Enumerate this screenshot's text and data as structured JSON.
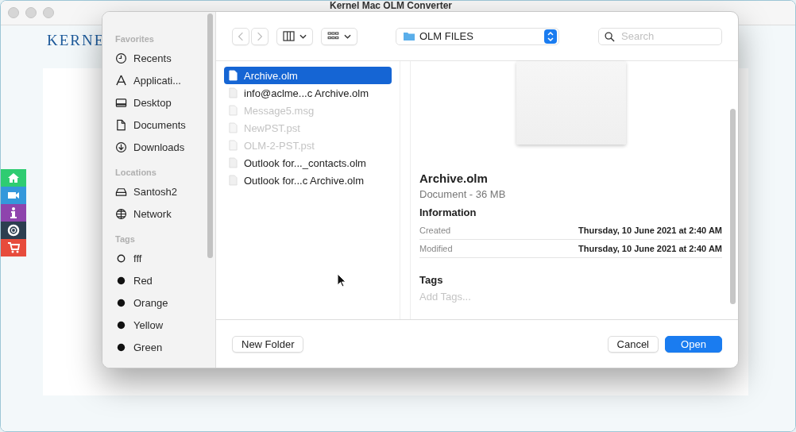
{
  "app_window": {
    "title": "Kernel Mac OLM Converter",
    "logo": "KERNE",
    "side_tabs": [
      {
        "kind": "home",
        "color": "#2ecc71"
      },
      {
        "kind": "video",
        "color": "#3498db"
      },
      {
        "kind": "info",
        "color": "#8e44ad"
      },
      {
        "kind": "help",
        "color": "#2c3e50"
      },
      {
        "kind": "cart",
        "color": "#e74c3c"
      }
    ]
  },
  "dialog": {
    "sidebar": [
      {
        "heading": "Favorites",
        "items": [
          {
            "label": "Recents",
            "kind": "clock"
          },
          {
            "label": "Applicati...",
            "kind": "apps"
          },
          {
            "label": "Desktop",
            "kind": "desktop"
          },
          {
            "label": "Documents",
            "kind": "doc"
          },
          {
            "label": "Downloads",
            "kind": "download"
          }
        ]
      },
      {
        "heading": "Locations",
        "items": [
          {
            "label": "Santosh2",
            "kind": "drive"
          },
          {
            "label": "Network",
            "kind": "globe"
          }
        ]
      },
      {
        "heading": "Tags",
        "items": [
          {
            "label": "fff",
            "kind": "ring"
          },
          {
            "label": "Red",
            "kind": "dot"
          },
          {
            "label": "Orange",
            "kind": "dot"
          },
          {
            "label": "Yellow",
            "kind": "dot"
          },
          {
            "label": "Green",
            "kind": "dot"
          }
        ]
      }
    ],
    "location": "OLM FILES",
    "search": {
      "placeholder": "Search"
    },
    "files": [
      {
        "name": "Archive.olm",
        "selected": true,
        "disabled": false
      },
      {
        "name": "info@aclme...c Archive.olm",
        "selected": false,
        "disabled": false
      },
      {
        "name": "Message5.msg",
        "selected": false,
        "disabled": true
      },
      {
        "name": "NewPST.pst",
        "selected": false,
        "disabled": true
      },
      {
        "name": "OLM-2-PST.pst",
        "selected": false,
        "disabled": true
      },
      {
        "name": "Outlook for..._contacts.olm",
        "selected": false,
        "disabled": false
      },
      {
        "name": "Outlook for...c Archive.olm",
        "selected": false,
        "disabled": false
      }
    ],
    "preview": {
      "name": "Archive.olm",
      "subtitle": "Document - 36 MB",
      "info_heading": "Information",
      "info": [
        {
          "label": "Created",
          "value": "Thursday, 10 June 2021 at 2:40 AM"
        },
        {
          "label": "Modified",
          "value": "Thursday, 10 June 2021 at 2:40 AM"
        }
      ],
      "tags_heading": "Tags",
      "tags_placeholder": "Add Tags..."
    },
    "buttons": {
      "new_folder": "New Folder",
      "cancel": "Cancel",
      "open": "Open"
    }
  }
}
